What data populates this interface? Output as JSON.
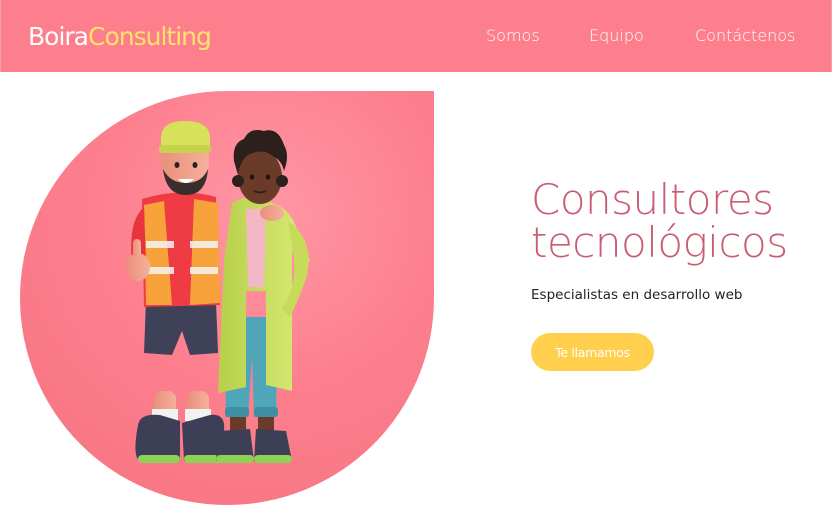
{
  "brand": {
    "part1": "Boira",
    "part2": "Consulting"
  },
  "nav": {
    "somos": "Somos",
    "equipo": "Equipo",
    "contactenos": "Contáctenos"
  },
  "hero": {
    "title_line1": "Consultores",
    "title_line2": "tecnológicos",
    "subtitle": "Especialistas en desarrollo web",
    "cta_label": "Te llamamos"
  },
  "colors": {
    "header_bg": "#fd7f8e",
    "brand_accent": "#ffe26a",
    "title": "#c95c73",
    "cta_bg": "#ffcf4d"
  }
}
